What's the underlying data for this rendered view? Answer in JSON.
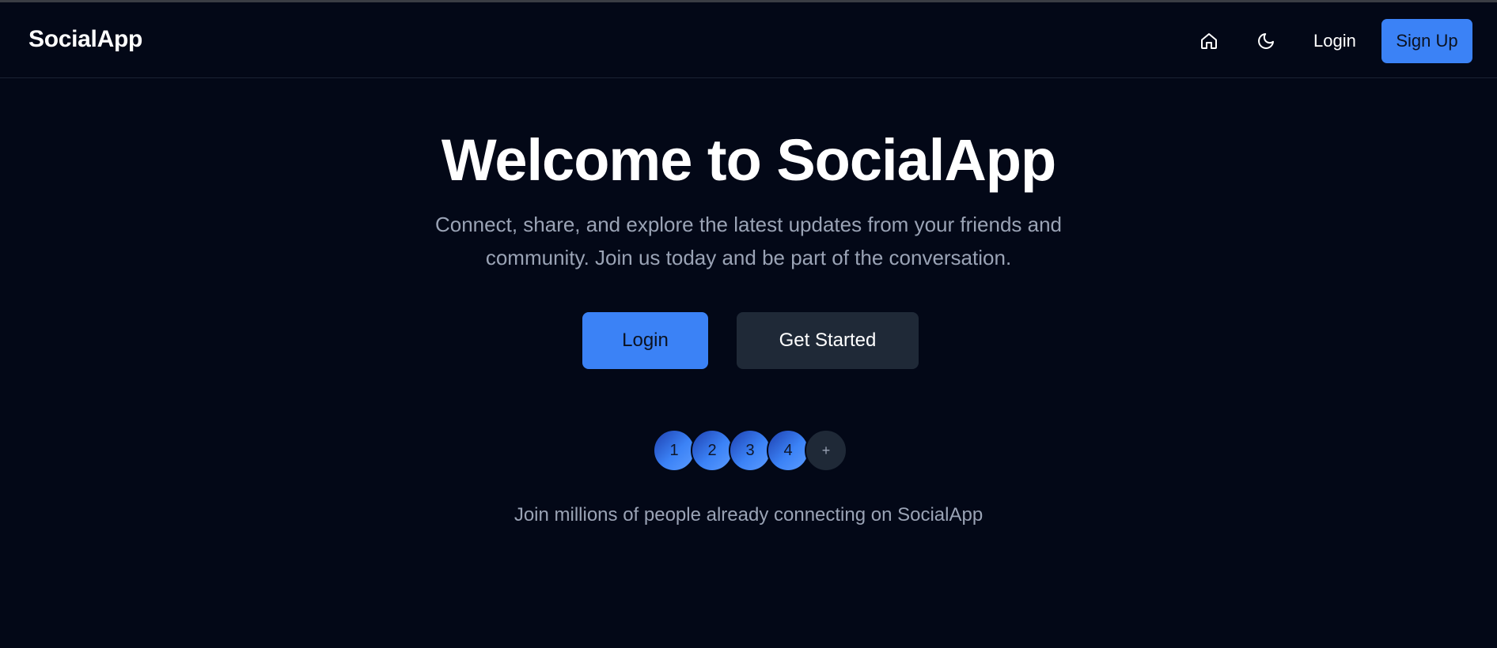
{
  "header": {
    "brand": "SocialApp",
    "home_icon": "home-icon",
    "theme_icon": "moon-icon",
    "login_label": "Login",
    "signup_label": "Sign Up"
  },
  "hero": {
    "title": "Welcome to SocialApp",
    "subtitle": "Connect, share, and explore the latest updates from your friends and community. Join us today and be part of the conversation.",
    "login_label": "Login",
    "get_started_label": "Get Started"
  },
  "avatars": {
    "items": [
      "1",
      "2",
      "3",
      "4"
    ],
    "more_label": "+"
  },
  "footer_text": "Join millions of people already connecting on SocialApp",
  "colors": {
    "background": "#030817",
    "accent": "#3b82f6",
    "secondary_button": "#1f2937",
    "muted_text": "#9aa3b5"
  }
}
